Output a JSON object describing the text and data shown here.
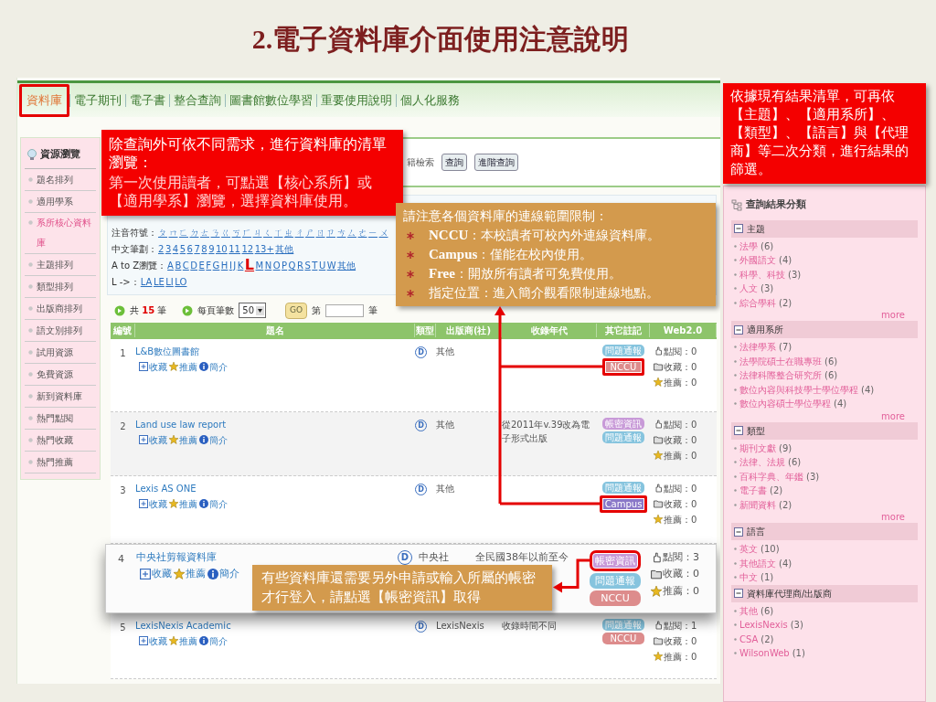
{
  "slide": {
    "title": "2.電子資料庫介面使用注意說明"
  },
  "nav": [
    {
      "label": "資料庫",
      "selected": true,
      "highlighted": true
    },
    {
      "label": "電子期刊",
      "selected": false,
      "highlighted": false
    },
    {
      "label": "電子書",
      "selected": false,
      "highlighted": false
    },
    {
      "label": "整合查詢",
      "selected": false,
      "highlighted": false
    },
    {
      "label": "圖書館數位學習",
      "selected": false,
      "highlighted": false
    },
    {
      "label": "重要使用說明",
      "selected": false,
      "highlighted": false
    },
    {
      "label": "個人化服務",
      "selected": false,
      "highlighted": false
    }
  ],
  "sidebar": {
    "title": "資源瀏覽",
    "items": [
      {
        "label": "題名排列",
        "selected": false
      },
      {
        "label": "適用學系",
        "selected": false
      },
      {
        "label": "系所核心資料庫",
        "selected": true
      },
      {
        "label": "主題排列",
        "selected": false
      },
      {
        "label": "類型排列",
        "selected": false
      },
      {
        "label": "出版商排列",
        "selected": false
      },
      {
        "label": "語文別排列",
        "selected": false
      },
      {
        "label": "試用資源",
        "selected": false
      },
      {
        "label": "免費資源",
        "selected": false
      },
      {
        "label": "新到資料庫",
        "selected": false
      },
      {
        "label": "熱門點閱",
        "selected": false
      },
      {
        "label": "熱門收藏",
        "selected": false
      },
      {
        "label": "熱門推薦",
        "selected": false
      }
    ]
  },
  "search": {
    "label": "籍檢索",
    "buttons": [
      "查詢",
      "進階查詢"
    ]
  },
  "browse": [
    {
      "label": "注音符號：",
      "links": [
        "ㄆ",
        "ㄇ",
        "ㄈ",
        "ㄉ",
        "ㄊ",
        "ㄋ",
        "ㄍ",
        "ㄎ",
        "ㄏ",
        "ㄐ",
        "ㄑ",
        "ㄒ",
        "ㄓ",
        "ㄔ",
        "ㄕ",
        "ㄖ",
        "ㄗ",
        "ㄘ",
        "ㄙ",
        "ㄜ",
        "ㄧ",
        "ㄨ"
      ]
    },
    {
      "label": "中文筆劃：",
      "links": [
        "2",
        "3",
        "4",
        "5",
        "6",
        "7",
        "8",
        "9",
        "10",
        "11",
        "12",
        "13+",
        "其他"
      ]
    },
    {
      "label": "A to Z瀏覽：",
      "links": [
        {
          "text": "A",
          "selected": false
        },
        {
          "text": "B",
          "selected": false
        },
        {
          "text": "C",
          "selected": false
        },
        {
          "text": "D",
          "selected": false
        },
        {
          "text": "E",
          "selected": false
        },
        {
          "text": "F",
          "selected": false
        },
        {
          "text": "G",
          "selected": false
        },
        {
          "text": "H",
          "selected": false
        },
        {
          "text": "I",
          "selected": false
        },
        {
          "text": "J",
          "selected": false
        },
        {
          "text": "K",
          "selected": false
        },
        {
          "text": "L",
          "selected": true
        },
        {
          "text": "M",
          "selected": false
        },
        {
          "text": "N",
          "selected": false
        },
        {
          "text": "O",
          "selected": false
        },
        {
          "text": "P",
          "selected": false
        },
        {
          "text": "Q",
          "selected": false
        },
        {
          "text": "R",
          "selected": false
        },
        {
          "text": "S",
          "selected": false
        },
        {
          "text": "T",
          "selected": false
        },
        {
          "text": "U",
          "selected": false
        },
        {
          "text": "W",
          "selected": false
        },
        {
          "text": "其他",
          "selected": false
        }
      ]
    },
    {
      "label": "L ->：",
      "links": [
        "LA",
        "LE",
        "LI",
        "LO"
      ]
    }
  ],
  "paging": {
    "total": "共 **15** 筆",
    "per_page_label": "每頁筆數",
    "per_page": "50",
    "go": "GO",
    "jump_prefix": "第",
    "jump_suffix": "筆"
  },
  "table": {
    "columns": [
      "編號",
      "題名",
      "類型",
      "出版商(社)",
      "收錄年代",
      "其它註記",
      "Web2.0"
    ],
    "rows": [
      {
        "number": "1",
        "title": "L&B數位圖書館",
        "actions": [
          {
            "kind": "collect",
            "label": "收藏"
          },
          {
            "kind": "recommend",
            "label": "推薦"
          },
          {
            "kind": "intro",
            "label": "簡介"
          }
        ],
        "type": "D",
        "publisher": "其他",
        "tags": [
          {
            "kind": "report",
            "label": "問題通報",
            "highlighted": false
          },
          {
            "kind": "nccu",
            "label": "NCCU",
            "highlighted": true
          }
        ],
        "stats": [
          {
            "kind": "views",
            "label": "點閱：0"
          },
          {
            "kind": "saves",
            "label": "收藏：0"
          },
          {
            "kind": "likes",
            "label": "推薦：0"
          }
        ],
        "enlarged": false
      },
      {
        "number": "2",
        "title": "Land use law report",
        "actions": [
          {
            "kind": "collect",
            "label": "收藏"
          },
          {
            "kind": "recommend",
            "label": "推薦"
          },
          {
            "kind": "intro",
            "label": "簡介"
          }
        ],
        "type": "D",
        "publisher": "其他",
        "coverage": "從2011年v.39改為電子形式出版",
        "tags": [
          {
            "kind": "account",
            "label": "帳密資訊",
            "highlighted": false
          },
          {
            "kind": "report",
            "label": "問題通報",
            "highlighted": false
          }
        ],
        "stats": [
          {
            "kind": "views",
            "label": "點閱：0"
          },
          {
            "kind": "saves",
            "label": "收藏：0"
          },
          {
            "kind": "likes",
            "label": "推薦：0"
          }
        ],
        "enlarged": false
      },
      {
        "number": "3",
        "title": "Lexis AS ONE",
        "actions": [
          {
            "kind": "collect",
            "label": "收藏"
          },
          {
            "kind": "recommend",
            "label": "推薦"
          },
          {
            "kind": "intro",
            "label": "簡介"
          }
        ],
        "type": "D",
        "publisher": "其他",
        "tags": [
          {
            "kind": "report",
            "label": "問題通報",
            "highlighted": false
          },
          {
            "kind": "campus",
            "label": "Campus",
            "highlighted": true
          }
        ],
        "stats": [
          {
            "kind": "views",
            "label": "點閱：0"
          },
          {
            "kind": "saves",
            "label": "收藏：0"
          },
          {
            "kind": "likes",
            "label": "推薦：0"
          }
        ],
        "enlarged": false
      },
      {
        "number": "4",
        "title": "中央社剪報資料庫",
        "actions": [
          {
            "kind": "collect",
            "label": "收藏"
          },
          {
            "kind": "recommend",
            "label": "推薦"
          },
          {
            "kind": "intro",
            "label": "簡介"
          }
        ],
        "type": "D",
        "publisher": "中央社",
        "coverage": "全民國38年以前至今",
        "tags": [
          {
            "kind": "account",
            "label": "帳密資訊",
            "highlighted": true
          },
          {
            "kind": "report",
            "label": "問題通報",
            "highlighted": false
          },
          {
            "kind": "nccu",
            "label": "NCCU",
            "highlighted": false
          }
        ],
        "stats": [
          {
            "kind": "views",
            "label": "點閱：3"
          },
          {
            "kind": "saves",
            "label": "收藏：0"
          },
          {
            "kind": "likes",
            "label": "推薦：0"
          }
        ],
        "enlarged": true,
        "note": "有些資料庫還需要另外申請或輸入所屬的帳密才行登入，請點選【帳密資訊】取得"
      },
      {
        "number": "5",
        "title": "LexisNexis Academic",
        "actions": [
          {
            "kind": "collect",
            "label": "收藏"
          },
          {
            "kind": "recommend",
            "label": "推薦"
          },
          {
            "kind": "intro",
            "label": "簡介"
          }
        ],
        "type": "D",
        "publisher": "LexisNexis",
        "coverage": "收錄時間不同",
        "tags": [
          {
            "kind": "report",
            "label": "問題通報",
            "highlighted": false
          },
          {
            "kind": "nccu",
            "label": "NCCU",
            "highlighted": false
          }
        ],
        "stats": [
          {
            "kind": "views",
            "label": "點閱：1"
          },
          {
            "kind": "saves",
            "label": "收藏：0"
          },
          {
            "kind": "likes",
            "label": "推薦：0"
          }
        ],
        "enlarged": false
      }
    ]
  },
  "browse_note": {
    "heading": "除查詢外可依不同需求，進行資料庫的清單瀏覽：",
    "body": "第一次使用讀者，可點選【核心系所】或【適用學系】瀏覽，選擇資料庫使用。"
  },
  "access_note": {
    "heading": "請注意各個資料庫的連線範圍限制：",
    "items": [
      "**NCCU**：本校讀者可校內外連線資料庫。",
      "**Campus**：僅能在校內使用。",
      "**Free**：開放所有讀者可免費使用。",
      "指定位置：進入簡介觀看限制連線地點。"
    ]
  },
  "filter_note": "依據現有結果清單，可再依【主題】、【適用系所】、【類型】、【語言】與【代理商】等二次分類，進行結果的篩選。",
  "facets": {
    "title": "查詢結果分類",
    "groups": [
      {
        "label": "主題",
        "expanded": true,
        "items": [
          {
            "label": "法學",
            "count": "(6)"
          },
          {
            "label": "外國語文",
            "count": "(4)"
          },
          {
            "label": "科學、科技",
            "count": "(3)"
          },
          {
            "label": "人文",
            "count": "(3)"
          },
          {
            "label": "綜合學科",
            "count": "(2)"
          }
        ],
        "more": "more"
      },
      {
        "label": "適用系所",
        "expanded": true,
        "items": [
          {
            "label": "法律學系",
            "count": "(7)"
          },
          {
            "label": "法學院碩士在職專班",
            "count": "(6)"
          },
          {
            "label": "法律科際整合研究所",
            "count": "(6)"
          },
          {
            "label": "數位內容與科技學士學位學程",
            "count": "(4)"
          },
          {
            "label": "數位內容碩士學位學程",
            "count": "(4)"
          }
        ],
        "more": "more"
      },
      {
        "label": "類型",
        "expanded": true,
        "items": [
          {
            "label": "期刊文獻",
            "count": "(9)"
          },
          {
            "label": "法律、法規",
            "count": "(6)"
          },
          {
            "label": "百科字典、年鑑",
            "count": "(3)"
          },
          {
            "label": "電子書",
            "count": "(2)"
          },
          {
            "label": "新聞資料",
            "count": "(2)"
          }
        ],
        "more": "more"
      },
      {
        "label": "語言",
        "expanded": true,
        "items": [
          {
            "label": "英文",
            "count": "(10)"
          },
          {
            "label": "其他語文",
            "count": "(4)"
          },
          {
            "label": "中文",
            "count": "(1)"
          }
        ]
      },
      {
        "label": "資料庫代理商/出版商",
        "expanded": true,
        "items": [
          {
            "label": "其他",
            "count": "(6)"
          },
          {
            "label": "LexisNexis",
            "count": "(3)"
          },
          {
            "label": "CSA",
            "count": "(2)"
          },
          {
            "label": "WilsonWeb",
            "count": "(1)"
          }
        ]
      }
    ]
  }
}
